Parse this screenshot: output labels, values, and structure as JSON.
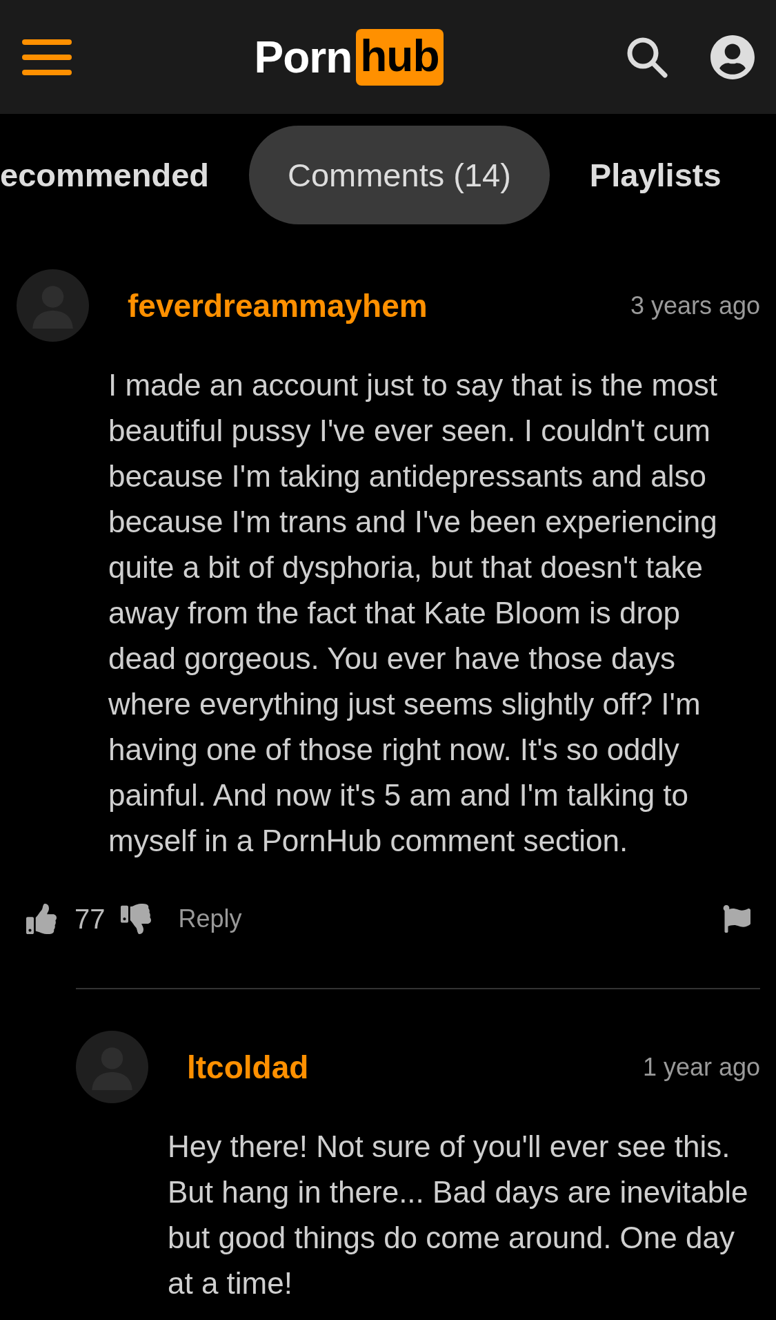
{
  "header": {
    "logo_left": "Porn",
    "logo_right": "hub"
  },
  "tabs": [
    {
      "label": "ecommended",
      "selected": false
    },
    {
      "label": "Comments (14)",
      "selected": true
    },
    {
      "label": "Playlists",
      "selected": false
    }
  ],
  "comments": [
    {
      "username": "feverdreammayhem",
      "time": "3 years ago",
      "body": "I made an account just to say that is the most beautiful pussy I've ever seen. I couldn't cum because I'm taking antidepressants and also because I'm trans and I've been experiencing quite a bit of dysphoria, but that doesn't take away from the fact that Kate Bloom is drop dead gorgeous. You ever have those days where everything just seems slightly off? I'm having one of those right now. It's so oddly painful. And now it's 5 am and I'm talking to myself in a PornHub comment section.",
      "likes": "77",
      "reply": "Reply",
      "children": [
        {
          "username": "ltcoldad",
          "time": "1 year ago",
          "body": "Hey there! Not sure of you'll ever see this. But hang in there... Bad days are inevitable but good things do come around. One day at a time!"
        }
      ]
    }
  ]
}
